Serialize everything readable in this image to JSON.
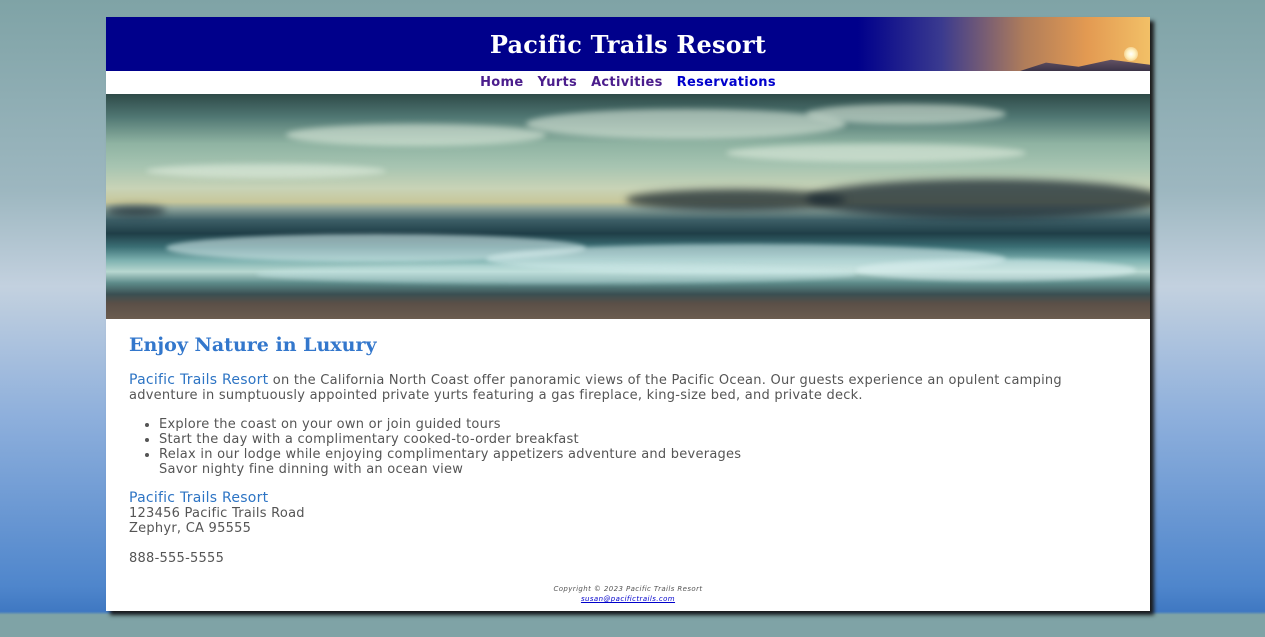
{
  "header": {
    "title": "Pacific Trails Resort"
  },
  "nav": [
    {
      "label": "Home"
    },
    {
      "label": "Yurts"
    },
    {
      "label": "Activities"
    },
    {
      "label": "Reservations"
    }
  ],
  "main": {
    "heading": "Enjoy Nature in Luxury",
    "intro_brand": "Pacific Trails Resort",
    "intro_text": " on the California North Coast offer panoramic views of the Pacific Ocean. Our guests experience an opulent camping adventure in sumptuously appointed private yurts featuring a gas fireplace, king-size bed, and private deck.",
    "features": [
      "Explore the coast on your own or join guided tours",
      "Start the day with a complimentary cooked-to-order breakfast",
      "Relax in our lodge while enjoying complimentary appetizers adventure and beverages",
      "Savor nighty fine dinning with an ocean view"
    ],
    "contact": {
      "name": "Pacific Trails Resort",
      "street": "123456 Pacific Trails Road",
      "city": "Zephyr, CA 95555",
      "phone": "888-555-5555"
    }
  },
  "footer": {
    "copyright": "Copyright © 2023 Pacific Trails Resort",
    "email": "susan@pacifictrails.com"
  }
}
